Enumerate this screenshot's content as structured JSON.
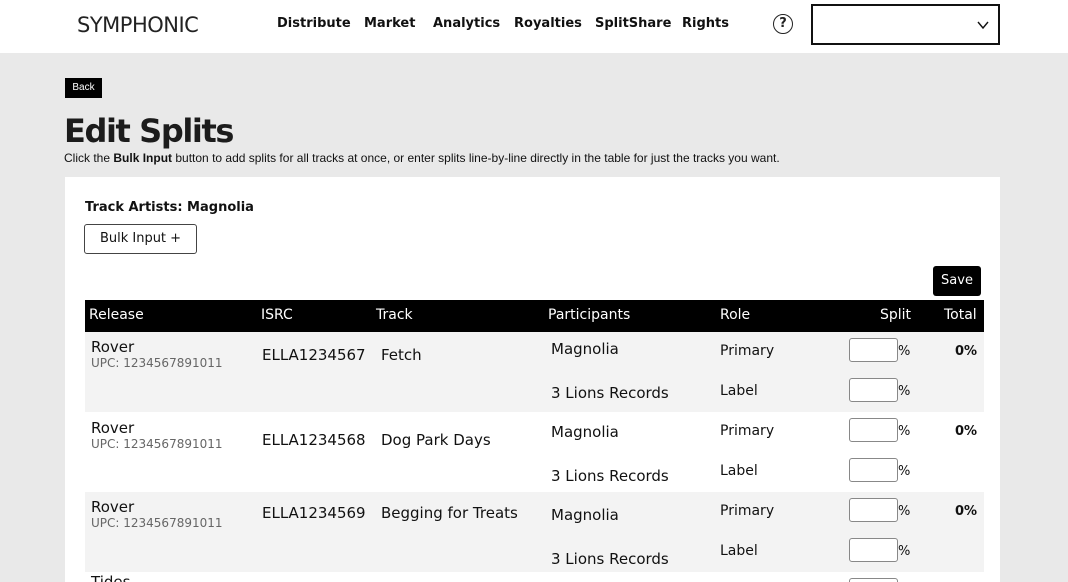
{
  "header": {
    "logo": "SYMPHONIC",
    "nav": [
      "Distribute",
      "Market",
      "Analytics",
      "Royalties",
      "SplitShare",
      "Rights"
    ],
    "help_icon": "question-circle-icon",
    "account_select": {
      "value": "",
      "icon": "chevron-down-icon"
    }
  },
  "page": {
    "back_label": "Back",
    "title": "Edit Splits",
    "instructions_pre": "Click the ",
    "instructions_bold": "Bulk Input",
    "instructions_post": " button to add splits for all tracks at once, or enter splits line-by-line directly in the table for just the tracks you want.",
    "track_artists": "Track Artists: Magnolia",
    "bulk_input_label": "Bulk Input +",
    "save_label": "Save"
  },
  "table": {
    "columns": [
      "Release",
      "ISRC",
      "Track",
      "Participants",
      "Role",
      "Split",
      "Total"
    ],
    "rows": [
      {
        "release": "Rover",
        "upc": "UPC: 1234567891011",
        "isrc": "ELLA1234567",
        "track": "Fetch",
        "total": "0%",
        "participants": [
          {
            "name": "Magnolia",
            "role": "Primary",
            "split": "",
            "pct": "%"
          },
          {
            "name": "3 Lions Records",
            "role": "Label",
            "split": "",
            "pct": "%"
          }
        ]
      },
      {
        "release": "Rover",
        "upc": "UPC: 1234567891011",
        "isrc": "ELLA1234568",
        "track": "Dog Park Days",
        "total": "0%",
        "participants": [
          {
            "name": "Magnolia",
            "role": "Primary",
            "split": "",
            "pct": "%"
          },
          {
            "name": "3 Lions Records",
            "role": "Label",
            "split": "",
            "pct": "%"
          }
        ]
      },
      {
        "release": "Rover",
        "upc": "UPC: 1234567891011",
        "isrc": "ELLA1234569",
        "track": "Begging for Treats",
        "total": "0%",
        "participants": [
          {
            "name": "Magnolia",
            "role": "Primary",
            "split": "",
            "pct": "%"
          },
          {
            "name": "3 Lions Records",
            "role": "Label",
            "split": "",
            "pct": "%"
          }
        ]
      },
      {
        "release": "Tides"
      }
    ]
  }
}
